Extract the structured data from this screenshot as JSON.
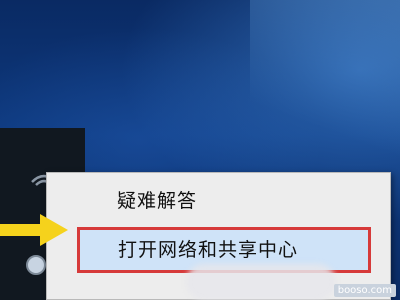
{
  "context_menu": {
    "items": [
      {
        "label": "疑难解答"
      },
      {
        "label": "打开网络和共享中心"
      }
    ]
  },
  "watermark": {
    "text": "booso.com"
  },
  "colors": {
    "desktop_blue": "#0e3a80",
    "menu_bg": "#ededed",
    "highlight_bg": "#cfe3f8",
    "highlight_border": "#d63a3a",
    "arrow": "#f5d21c"
  },
  "icons": [
    "wifi-icon",
    "network-icon",
    "pointer-arrow-icon"
  ]
}
